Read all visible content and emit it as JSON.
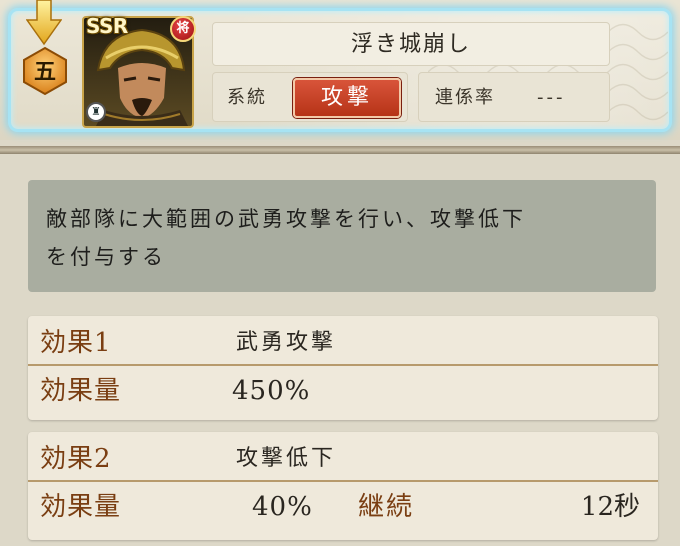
{
  "header": {
    "rank_glyph": "五",
    "rarity": "SSR",
    "general_mark": "将",
    "skill_name": "浮き城崩し",
    "system_label": "系統",
    "skill_type": "攻撃",
    "link_label": "連係率",
    "link_value": "---"
  },
  "description": {
    "line1": "敵部隊に大範囲の武勇攻撃を行い、攻撃低下",
    "line2": "を付与する"
  },
  "effects": [
    {
      "key": "効果1",
      "name": "武勇攻撃",
      "amount_label": "効果量",
      "amount": "450%"
    },
    {
      "key": "効果2",
      "name": "攻撃低下",
      "amount_label": "効果量",
      "amount": "40%",
      "duration_label": "継続",
      "duration": "12秒"
    }
  ],
  "colors": {
    "frame_glow": "#a7e3f3",
    "type_badge": "#c4401f",
    "effect_key": "#7a3e12",
    "description_bg": "#a9ada0"
  },
  "icons": {
    "arrow": "arrow-down-icon",
    "rank": "rank-badge-icon",
    "general": "general-mark-icon",
    "armor": "armor-icon"
  }
}
